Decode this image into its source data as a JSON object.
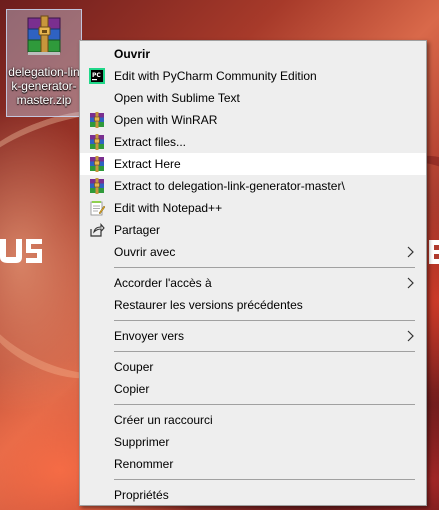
{
  "desktop": {
    "file_icon_name": "winrar-archive-icon",
    "file_label": "delegation-link-generator-master.zip"
  },
  "menu": {
    "items": [
      {
        "label": "Ouvrir",
        "bold": true,
        "icon": null
      },
      {
        "label": "Edit with PyCharm Community Edition",
        "icon": "pycharm-icon"
      },
      {
        "label": "Open with Sublime Text",
        "icon": null
      },
      {
        "label": "Open with WinRAR",
        "icon": "winrar-icon"
      },
      {
        "label": "Extract files...",
        "icon": "winrar-icon"
      },
      {
        "label": "Extract Here",
        "icon": "winrar-icon",
        "highlighted": true
      },
      {
        "label": "Extract to delegation-link-generator-master\\",
        "icon": "winrar-icon"
      },
      {
        "label": "Edit with Notepad++",
        "icon": "notepad-plus-plus-icon"
      },
      {
        "label": "Partager",
        "icon": "share-icon"
      },
      {
        "label": "Ouvrir avec",
        "icon": null,
        "submenu": true
      },
      {
        "label": "Accorder l'accès à",
        "icon": null,
        "submenu": true
      },
      {
        "label": "Restaurer les versions précédentes",
        "icon": null
      },
      {
        "label": "Envoyer vers",
        "icon": null,
        "submenu": true
      },
      {
        "label": "Couper",
        "icon": null
      },
      {
        "label": "Copier",
        "icon": null
      },
      {
        "label": "Créer un raccourci",
        "icon": null
      },
      {
        "label": "Supprimer",
        "icon": null
      },
      {
        "label": "Renommer",
        "icon": null
      },
      {
        "label": "Propriétés",
        "icon": null
      }
    ]
  },
  "colors": {
    "menu_background": "#eeeeee",
    "menu_highlight": "#ffffff",
    "menu_border": "#a0a0a0",
    "icon_selection": "#cde1ff"
  }
}
